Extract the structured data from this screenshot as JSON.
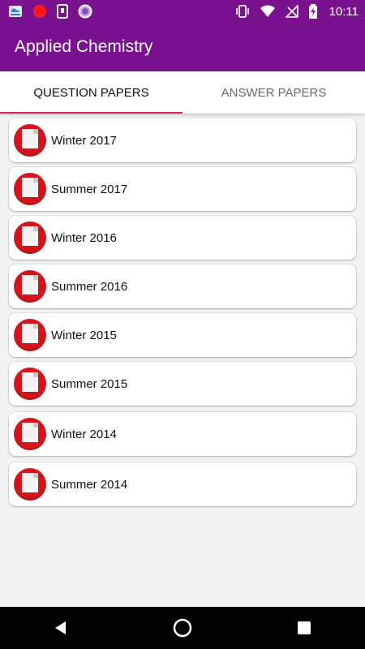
{
  "status_bar": {
    "time": "10:11",
    "left_icons": [
      "weather-icon",
      "red-dot-icon",
      "device-notification-icon",
      "circle-notification-icon"
    ],
    "right_icons": [
      "vibrate-icon",
      "wifi-icon",
      "no-signal-icon",
      "battery-charging-icon"
    ]
  },
  "app_bar": {
    "title": "Applied Chemistry"
  },
  "tabs": [
    {
      "label": "QUESTION PAPERS",
      "active": true
    },
    {
      "label": "ANSWER PAPERS",
      "active": false
    }
  ],
  "pdf_badge": "PDF",
  "papers": [
    {
      "label": "Winter 2017"
    },
    {
      "label": "Summer 2017"
    },
    {
      "label": "Winter 2016"
    },
    {
      "label": "Summer 2016"
    },
    {
      "label": "Winter 2015"
    },
    {
      "label": "Summer 2015"
    },
    {
      "label": "Winter 2014"
    },
    {
      "label": "Summer 2014"
    }
  ],
  "colors": {
    "primary": "#7a128f",
    "tab_indicator": "#e91e63",
    "pdf_red": "#d3151b"
  }
}
